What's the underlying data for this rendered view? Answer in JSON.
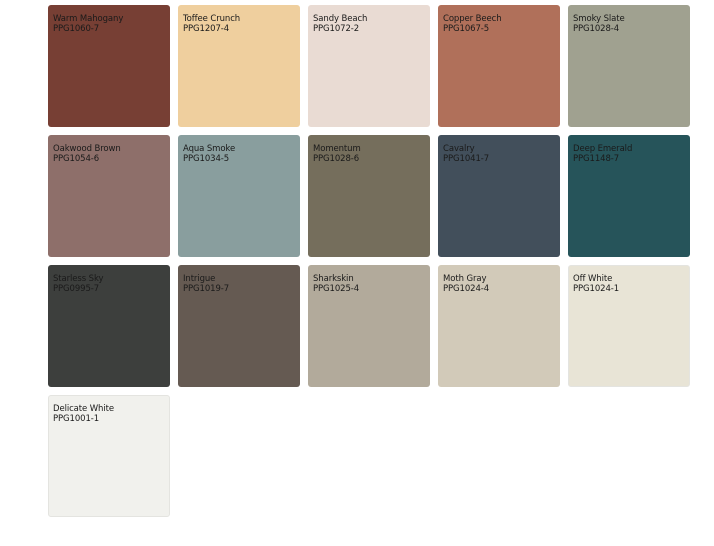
{
  "swatches": [
    {
      "name": "Warm Mahogany",
      "code": "PPG1060-7",
      "color": "#773f34"
    },
    {
      "name": "Toffee Crunch",
      "code": "PPG1207-4",
      "color": "#efcf9e"
    },
    {
      "name": "Sandy Beach",
      "code": "PPG1072-2",
      "color": "#e9dbd3"
    },
    {
      "name": "Copper Beech",
      "code": "PPG1067-5",
      "color": "#b0705a"
    },
    {
      "name": "Smoky Slate",
      "code": "PPG1028-4",
      "color": "#a0a190"
    },
    {
      "name": "Oakwood Brown",
      "code": "PPG1054-6",
      "color": "#8e6f6a"
    },
    {
      "name": "Aqua Smoke",
      "code": "PPG1034-5",
      "color": "#899e9e"
    },
    {
      "name": "Momentum",
      "code": "PPG1028-6",
      "color": "#756e5c"
    },
    {
      "name": "Cavalry",
      "code": "PPG1041-7",
      "color": "#424f5b"
    },
    {
      "name": "Deep Emerald",
      "code": "PPG1148-7",
      "color": "#26545a"
    },
    {
      "name": "Starless Sky",
      "code": "PPG0995-7",
      "color": "#3d3f3d"
    },
    {
      "name": "Intrigue",
      "code": "PPG1019-7",
      "color": "#655a52"
    },
    {
      "name": "Sharkskin",
      "code": "PPG1025-4",
      "color": "#b2aa9b"
    },
    {
      "name": "Moth Gray",
      "code": "PPG1024-4",
      "color": "#d2cab9"
    },
    {
      "name": "Off White",
      "code": "PPG1024-1",
      "color": "#e8e4d6"
    },
    {
      "name": "Delicate White",
      "code": "PPG1001-1",
      "color": "#f1f1ed"
    }
  ]
}
